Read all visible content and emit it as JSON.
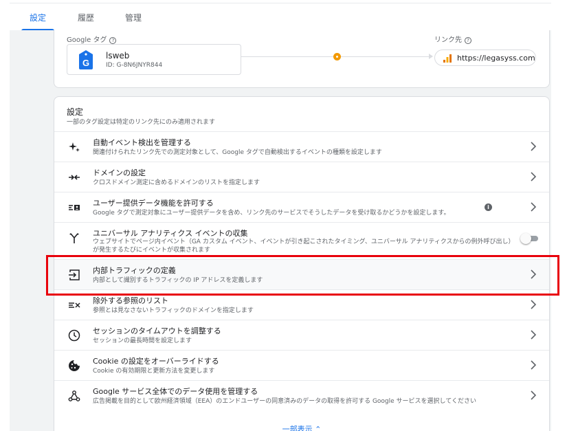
{
  "tabs": [
    "設定",
    "履歴",
    "管理"
  ],
  "tag_section": {
    "google_tag_label": "Google タグ",
    "link_label": "リンク先",
    "help_glyph": "?",
    "tag_name": "lsweb",
    "tag_id": "ID: G-8N6JNYR844",
    "link_url": "https://legasyss.com",
    "badge_letter": "G",
    "status_color": "#f29900"
  },
  "settings": {
    "title": "設定",
    "subtitle": "一部のタグ設定は特定のリンク先にのみ適用されます",
    "items": [
      {
        "title": "自動イベント検出を管理する",
        "desc": "関連付けられたリンク先での測定対象として、Google タグで自動検出するイベントの種類を設定します",
        "icon": "sparkle-icon"
      },
      {
        "title": "ドメインの設定",
        "desc": "クロスドメイン測定に含めるドメインのリストを指定します",
        "icon": "merge-arrows-icon"
      },
      {
        "title": "ユーザー提供データ機能を許可する",
        "desc": "Google タグで測定対象にユーザー提供データを含め、リンク先のサービスでそうしたデータを受け取るかどうかを設定します。",
        "icon": "user-data-icon"
      },
      {
        "title": "ユニバーサル アナリティクス イベントの収集",
        "desc": "ウェブサイトでページ内イベント（GA カスタム イベント、イベントが引き起こされたタイミング、ユニバーサル アナリティクスからの例外呼び出し）が発生するたびにイベントが収集されます",
        "icon": "fork-icon"
      },
      {
        "title": "内部トラフィックの定義",
        "desc": "内部として識別するトラフィックの IP アドレスを定義します",
        "icon": "login-box-icon"
      },
      {
        "title": "除外する参照のリスト",
        "desc": "参照とは見なさないトラフィックのドメインを指定します",
        "icon": "exclude-list-icon"
      },
      {
        "title": "セッションのタイムアウトを調整する",
        "desc": "セッションの最長時間を設定します",
        "icon": "clock-icon"
      },
      {
        "title": "Cookie の設定をオーバーライドする",
        "desc": "Cookie の有効期限と更新方法を変更します",
        "icon": "cookie-icon"
      },
      {
        "title": "Google サービス全体でのデータ使用を管理する",
        "desc": "広告掲載を目的として欧州経済領域（EEA）のエンドユーザーの同意済みのデータの取得を許可する Google サービスを選択してください",
        "icon": "share-nodes-icon"
      }
    ],
    "info_glyph": "i",
    "show_less": "一部表示 ⌃"
  },
  "highlight_color": "#e8000b"
}
